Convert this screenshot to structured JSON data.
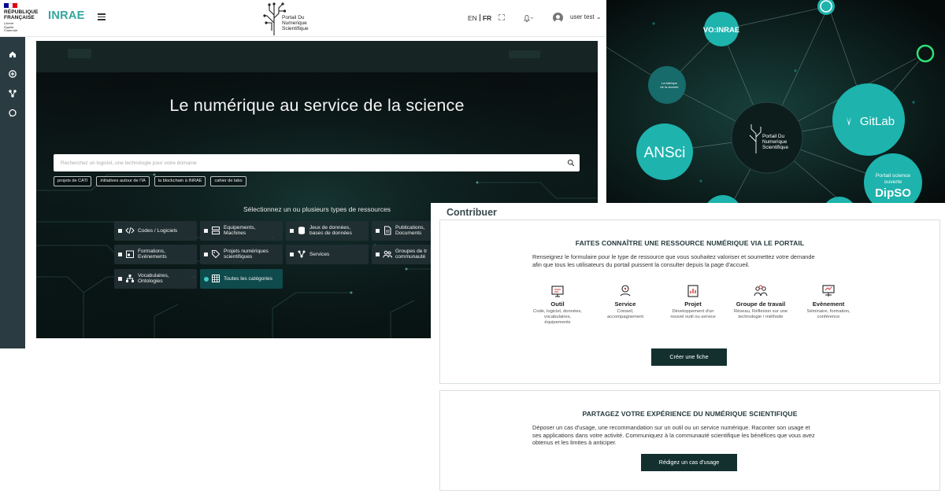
{
  "header": {
    "republique_lines": [
      "RÉPUBLIQUE",
      "FRANÇAISE"
    ],
    "republique_motto": [
      "Liberté",
      "Égalité",
      "Fraternité"
    ],
    "inrae_logo": "INRAE",
    "portal_name_lines": [
      "Portail Du",
      "Numerique",
      "Scientifique"
    ],
    "lang_en": "EN",
    "lang_fr": "FR",
    "user_label": "user test ⌄",
    "bell_caret": "⌄"
  },
  "hero": {
    "title": "Le numérique au service de la science",
    "search_placeholder": "Recherchez un logiciel, une technologie pour votre domaine",
    "tags": [
      "projets de CATI",
      "initiatives autour de l'IA",
      "la blockchain à INRAE",
      "cahier de labo"
    ],
    "types_title": "Sélectionnez un ou plusieurs types de ressources",
    "types": [
      {
        "label": "Codes / Logiciels",
        "icon": "code-icon"
      },
      {
        "label": "Equipements,\nMachines",
        "icon": "server-icon"
      },
      {
        "label": "Jeux de données,\nbases de données",
        "icon": "database-icon"
      },
      {
        "label": "Publications,\nDocuments",
        "icon": "document-icon"
      },
      {
        "label": "Formations,\nEvénements",
        "icon": "calendar-icon"
      },
      {
        "label": "Projets numériques\nscientifiques",
        "icon": "tag-icon"
      },
      {
        "label": "Services",
        "icon": "network-icon"
      },
      {
        "label": "Groupes de tr\ncommunauté",
        "icon": "users-icon"
      },
      {
        "label": "Vocabulaires,\nOntologies",
        "icon": "hierarchy-icon"
      },
      {
        "label": "Toutes les catégories",
        "icon": "grid-icon"
      }
    ]
  },
  "network": {
    "nodes": {
      "vo_inrae": "VO:INRAE",
      "ansci": "ANSci",
      "gitlab": "GitLab",
      "dipso_top": "Portail science",
      "dipso_mid": "ouverte",
      "dipso_brand": "DipSO",
      "center_lines": [
        "Portail Du",
        "Numerique",
        "Scientifique"
      ],
      "small_lines": [
        "La fabrique",
        "de la donnée"
      ]
    }
  },
  "contribuer": {
    "title": "Contribuer",
    "box1": {
      "heading": "FAITES CONNAÎTRE UNE RESSOURCE NUMÉRIQUE VIA LE PORTAIL",
      "desc_lines": [
        "Renseignez le formulaire pour le type de ressource que vous souhaitez valoriser et soumettez votre demande",
        "afin que tous les utilisateurs du portail puissent la consulter depuis la page d'accueil."
      ],
      "categories": [
        {
          "name": "Outil",
          "desc": "Code, logiciel, données,\nvocabulaires,\néquipements",
          "icon": "monitor-icon"
        },
        {
          "name": "Service",
          "desc": "Conseil,\naccompagnement",
          "icon": "service-icon"
        },
        {
          "name": "Projet",
          "desc": "Développement d'un\nnouvel outil ou service",
          "icon": "project-icon"
        },
        {
          "name": "Groupe de travail",
          "desc": "Réseau, Réflexion sur une\ntechnologie / méthode",
          "icon": "group-icon"
        },
        {
          "name": "Evènement",
          "desc": "Séminaire, formation,\nconférence",
          "icon": "event-icon"
        }
      ],
      "button": "Créer une fiche"
    },
    "box2": {
      "heading": "PARTAGEZ VOTRE EXPÉRIENCE DU NUMÉRIQUE SCIENTIFIQUE",
      "desc_lines": [
        "Déposer un cas d'usage, une recommandation sur un outil ou un service numérique. Raconter son usage et",
        "ses applications dans votre activité. Communiquez à la communauté scientifique les bénéfices que vous avez",
        "obtenus et les limites à anticiper."
      ],
      "button": "Rédigez un cas d'usage"
    }
  },
  "colors": {
    "accent": "#33a6a0",
    "sidebar": "#2a3c41",
    "button": "#13302f",
    "node": "#1eb3ad",
    "flag_blue": "#000091",
    "flag_red": "#e1000f"
  }
}
